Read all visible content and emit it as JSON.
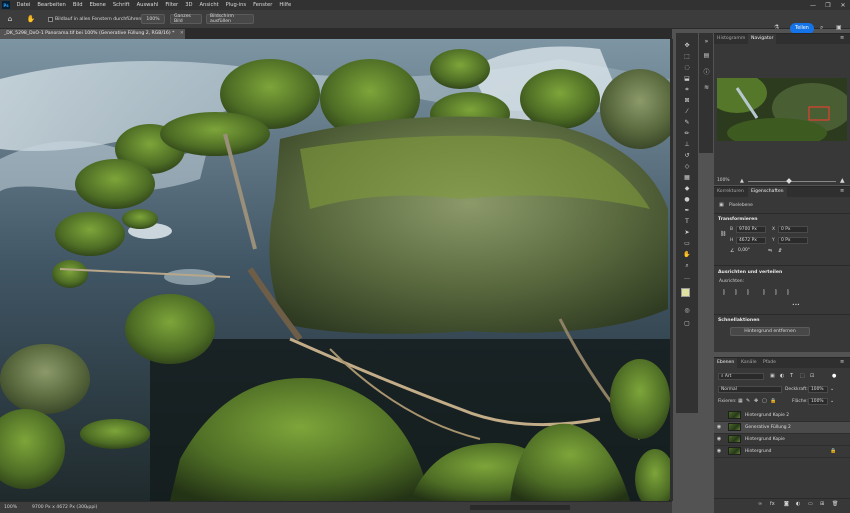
{
  "app": {
    "logo": "Ps"
  },
  "menu": [
    "Datei",
    "Bearbeiten",
    "Bild",
    "Ebene",
    "Schrift",
    "Auswahl",
    "Filter",
    "3D",
    "Ansicht",
    "Plug-ins",
    "Fenster",
    "Hilfe"
  ],
  "window_controls": [
    "—",
    "❐",
    "✕"
  ],
  "options": {
    "scroll_all_label": "Bildlauf in allen Fenstern durchführen",
    "zoom_100": "100%",
    "fit_screen": "Ganzes Bild",
    "fill_screen": "Bildschirm ausfüllen",
    "share": "Teilen"
  },
  "document": {
    "tab_title": "_DK_5298_DxO-1 Panorama.tif bei 100% (Generative Füllung 2, RGB/16) *",
    "close": "✕"
  },
  "status": {
    "zoom": "100%",
    "info": "9700 Px x 4672 Px (300 ppi)",
    "arrow": "›"
  },
  "panels": {
    "top_tabs": [
      "Histogramm",
      "Navigator"
    ],
    "navigator_zoom": "100%",
    "props_tabs": [
      "Korrekturen",
      "Eigenschaften"
    ],
    "pixel_layer": "Pixelebene",
    "transform": {
      "title": "Transformieren",
      "w_label": "B",
      "w": "9700 Px",
      "h_label": "H",
      "h": "4672 Px",
      "x_label": "X",
      "x": "0 Px",
      "y_label": "Y",
      "y": "0 Px",
      "angle": "0,00°"
    },
    "align": {
      "title": "Ausrichten und verteilen",
      "sub": "Ausrichten:",
      "more": "•••"
    },
    "quick": {
      "title": "Schnellaktionen",
      "button": "Hintergrund entfernen"
    },
    "layers_tabs": [
      "Ebenen",
      "Kanäle",
      "Pfade"
    ],
    "filter_label": "Art",
    "blend": "Normal",
    "opacity_label": "Deckkraft:",
    "opacity": "100%",
    "lock_label": "Fixieren:",
    "fill_label": "Fläche:",
    "fill": "100%",
    "layers": [
      {
        "name": "Hintergrund Kopie 2",
        "visible": false,
        "selected": false
      },
      {
        "name": "Generative Füllung 2",
        "visible": true,
        "selected": true
      },
      {
        "name": "Hintergrund Kopie",
        "visible": true,
        "selected": false
      },
      {
        "name": "Hintergrund",
        "visible": true,
        "selected": false
      }
    ],
    "layer_footer_icons": [
      "link-icon",
      "fx",
      "mask-icon",
      "adjust-icon",
      "folder-icon",
      "new-layer-icon",
      "trash-icon"
    ]
  },
  "colors": {
    "accent": "#1473e6",
    "fg_swatch": "#dfe3a2",
    "bg_swatch": "#e9f0c9"
  }
}
